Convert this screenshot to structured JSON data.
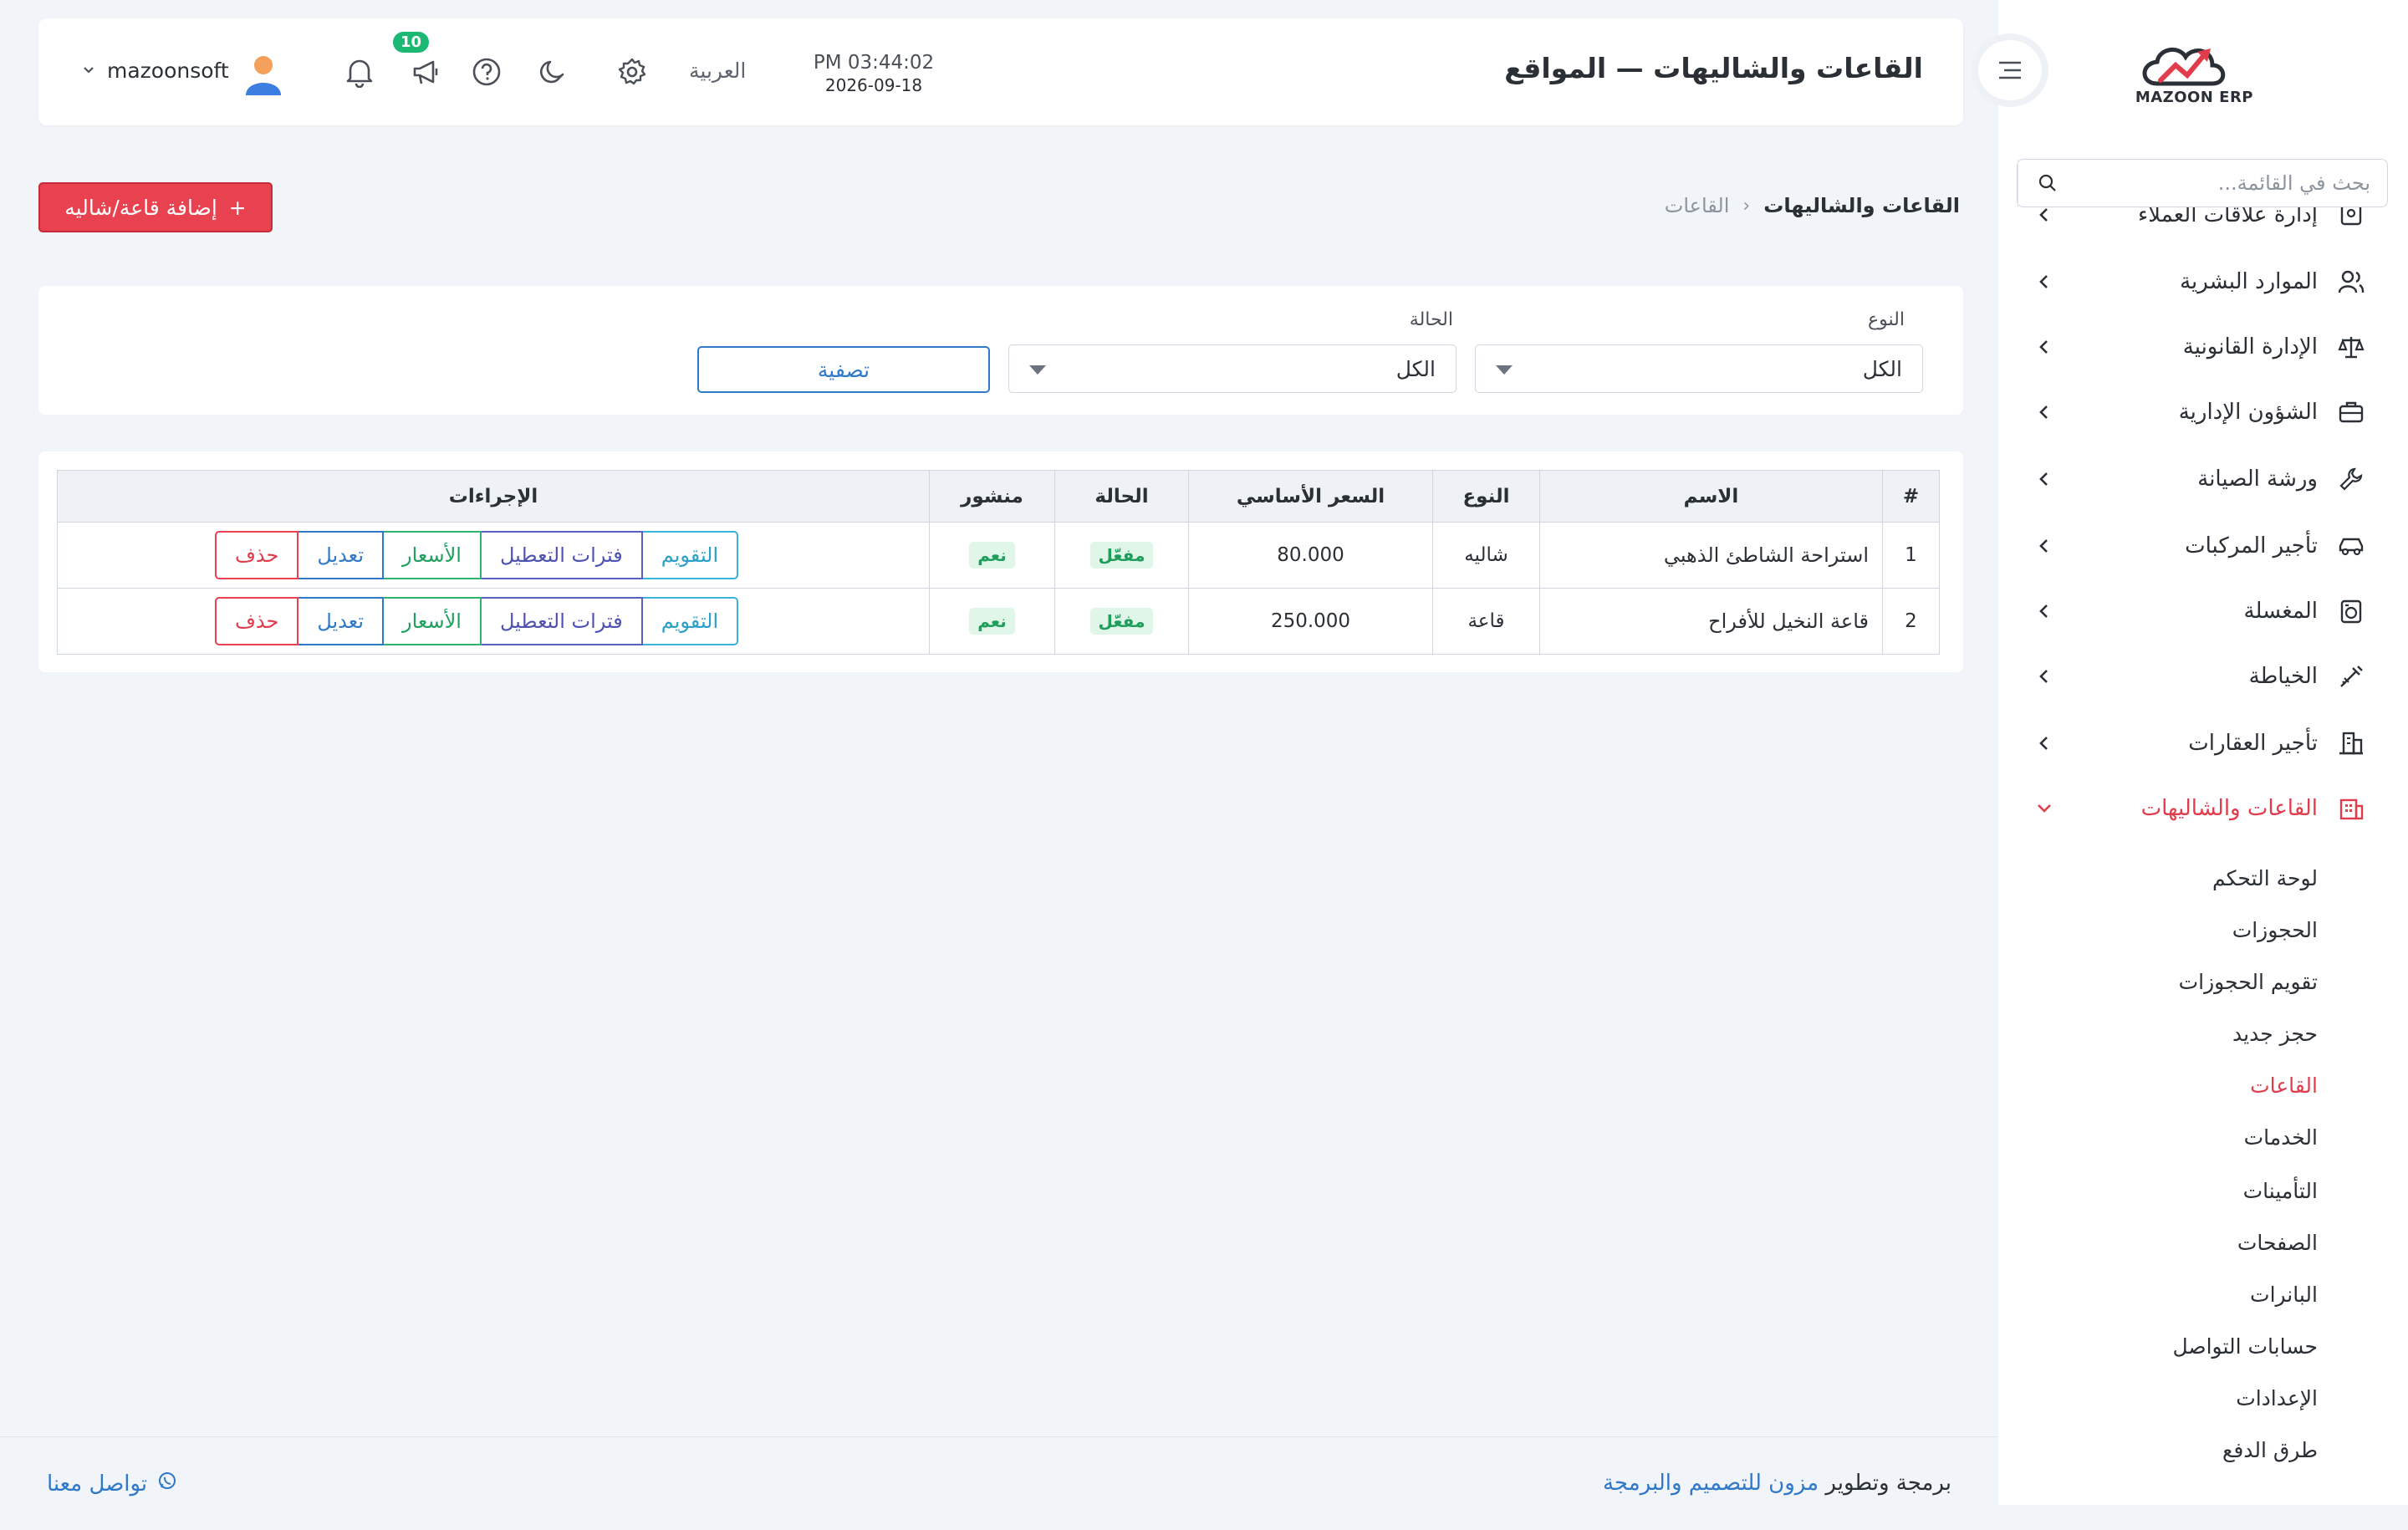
{
  "sidebar": {
    "logo_text": "MAZOON ERP",
    "search_placeholder": "بحث في القائمة...",
    "items": [
      {
        "label": "إدارة علاقات العملاء",
        "icon": "crm-icon"
      },
      {
        "label": "الموارد البشرية",
        "icon": "users-icon"
      },
      {
        "label": "الإدارة القانونية",
        "icon": "scale-icon"
      },
      {
        "label": "الشؤون الإدارية",
        "icon": "briefcase-icon"
      },
      {
        "label": "ورشة الصيانة",
        "icon": "wrench-icon"
      },
      {
        "label": "تأجير المركبات",
        "icon": "car-icon"
      },
      {
        "label": "المغسلة",
        "icon": "laundry-icon"
      },
      {
        "label": "الخياطة",
        "icon": "tailor-icon"
      },
      {
        "label": "تأجير العقارات",
        "icon": "building-icon"
      },
      {
        "label": "القاعات والشاليهات",
        "icon": "hall-icon"
      }
    ],
    "sub_items": [
      "لوحة التحكم",
      "الحجوزات",
      "تقويم الحجوزات",
      "حجز جديد",
      "القاعات",
      "الخدمات",
      "التأمينات",
      "الصفحات",
      "البانرات",
      "حسابات التواصل",
      "الإعدادات",
      "طرق الدفع"
    ]
  },
  "header": {
    "title": "القاعات والشاليهات — المواقع",
    "time": "PM 03:44:02",
    "date": "2026-09-18",
    "language": "العربية",
    "notification_count": "10",
    "username": "mazoonsoft"
  },
  "breadcrumb": {
    "main": "القاعات والشاليهات",
    "sep": "‹",
    "current": "القاعات"
  },
  "add_button": {
    "icon": "+",
    "label": "إضافة قاعة/شاليه"
  },
  "filters": {
    "type_label": "النوع",
    "type_value": "الكل",
    "status_label": "الحالة",
    "status_value": "الكل",
    "filter_button": "تصفية"
  },
  "table": {
    "headers": {
      "num": "#",
      "name": "الاسم",
      "type": "النوع",
      "price": "السعر الأساسي",
      "status": "الحالة",
      "published": "منشور",
      "actions": "الإجراءات"
    },
    "rows": [
      {
        "num": "1",
        "name": "استراحة الشاطئ الذهبي",
        "type": "شاليه",
        "price": "80.000",
        "status": "مفعّل",
        "published": "نعم"
      },
      {
        "num": "2",
        "name": "قاعة النخيل للأفراح",
        "type": "قاعة",
        "price": "250.000",
        "status": "مفعّل",
        "published": "نعم"
      }
    ],
    "actions": {
      "calendar": "التقويم",
      "blackouts": "فترات التعطيل",
      "prices": "الأسعار",
      "edit": "تعديل",
      "delete": "حذف"
    }
  },
  "footer": {
    "credit_prefix": "برمجة وتطوير",
    "credit_link": "مزون للتصميم والبرمجة",
    "contact": "تواصل معنا"
  },
  "colors": {
    "accent_red": "#e8414f",
    "accent_blue": "#2f79c8",
    "success_green": "#1cb873"
  }
}
